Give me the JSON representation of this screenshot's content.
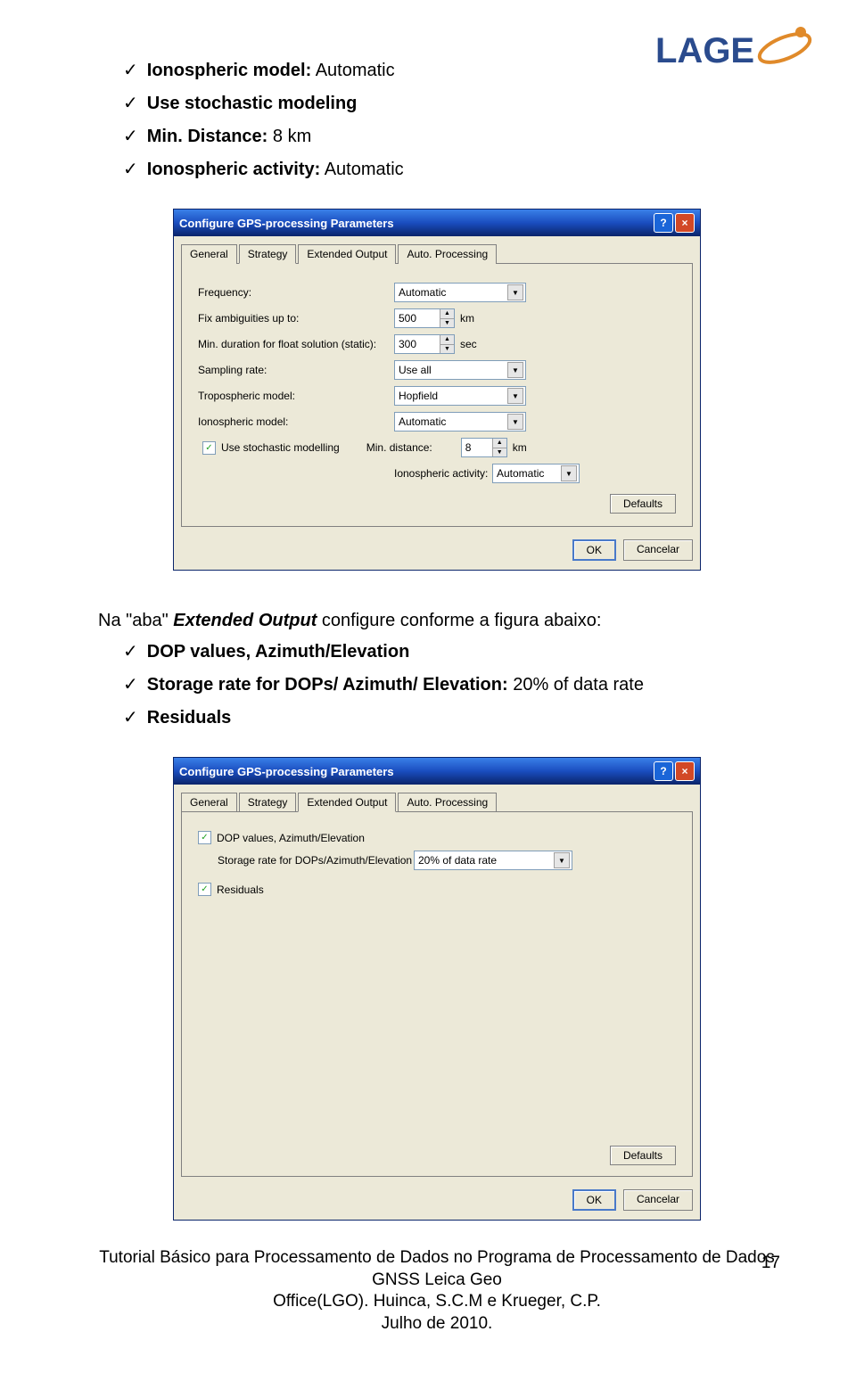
{
  "logo": {
    "text": "LAGE"
  },
  "bullets_top": [
    {
      "bold": "Ionospheric model:",
      "rest": " Automatic"
    },
    {
      "bold": "Use stochastic modeling",
      "rest": ""
    },
    {
      "bold": "Min. Distance:",
      "rest": " 8 km"
    },
    {
      "bold": "Ionospheric activity:",
      "rest": " Automatic"
    }
  ],
  "dialog1": {
    "title": "Configure GPS-processing Parameters",
    "tabs": [
      "General",
      "Strategy",
      "Extended Output",
      "Auto. Processing"
    ],
    "active_tab": "Strategy",
    "labels": {
      "frequency": "Frequency:",
      "fix_amb": "Fix ambiguities up to:",
      "min_dur": "Min. duration for float solution (static):",
      "sampling": "Sampling rate:",
      "tropo": "Tropospheric model:",
      "iono_model": "Ionospheric model:",
      "stochastic": "Use stochastic modelling",
      "min_dist": "Min. distance:",
      "iono_act": "Ionospheric activity:"
    },
    "values": {
      "frequency": "Automatic",
      "fix_amb": "500",
      "min_dur": "300",
      "sampling": "Use all",
      "tropo": "Hopfield",
      "iono_model": "Automatic",
      "min_dist": "8",
      "iono_act": "Automatic"
    },
    "units": {
      "km": "km",
      "sec": "sec"
    },
    "buttons": {
      "defaults": "Defaults",
      "ok": "OK",
      "cancel": "Cancelar"
    }
  },
  "intro2_a": "Na \"aba\" ",
  "intro2_b": "Extended Output",
  "intro2_c": "  configure conforme a figura abaixo:",
  "bullets_mid": [
    {
      "bold": "DOP values, Azimuth/Elevation",
      "rest": ""
    },
    {
      "bold": "Storage rate for DOPs/ Azimuth/ Elevation:",
      "rest": " 20% of data rate"
    },
    {
      "bold": "Residuals",
      "rest": ""
    }
  ],
  "dialog2": {
    "title": "Configure GPS-processing Parameters",
    "tabs": [
      "General",
      "Strategy",
      "Extended Output",
      "Auto. Processing"
    ],
    "active_tab": "Extended Output",
    "labels": {
      "dop": "DOP values, Azimuth/Elevation",
      "storage": "Storage rate for DOPs/Azimuth/Elevation",
      "residuals": "Residuals"
    },
    "values": {
      "storage": "20% of data rate"
    },
    "buttons": {
      "defaults": "Defaults",
      "ok": "OK",
      "cancel": "Cancelar"
    }
  },
  "page_number": "17",
  "footer": {
    "line1": "Tutorial Básico para Processamento de Dados no Programa de Processamento de Dados GNSS Leica Geo",
    "line2": "Office(LGO). Huinca, S.C.M e Krueger, C.P.",
    "line3": "Julho de 2010."
  }
}
